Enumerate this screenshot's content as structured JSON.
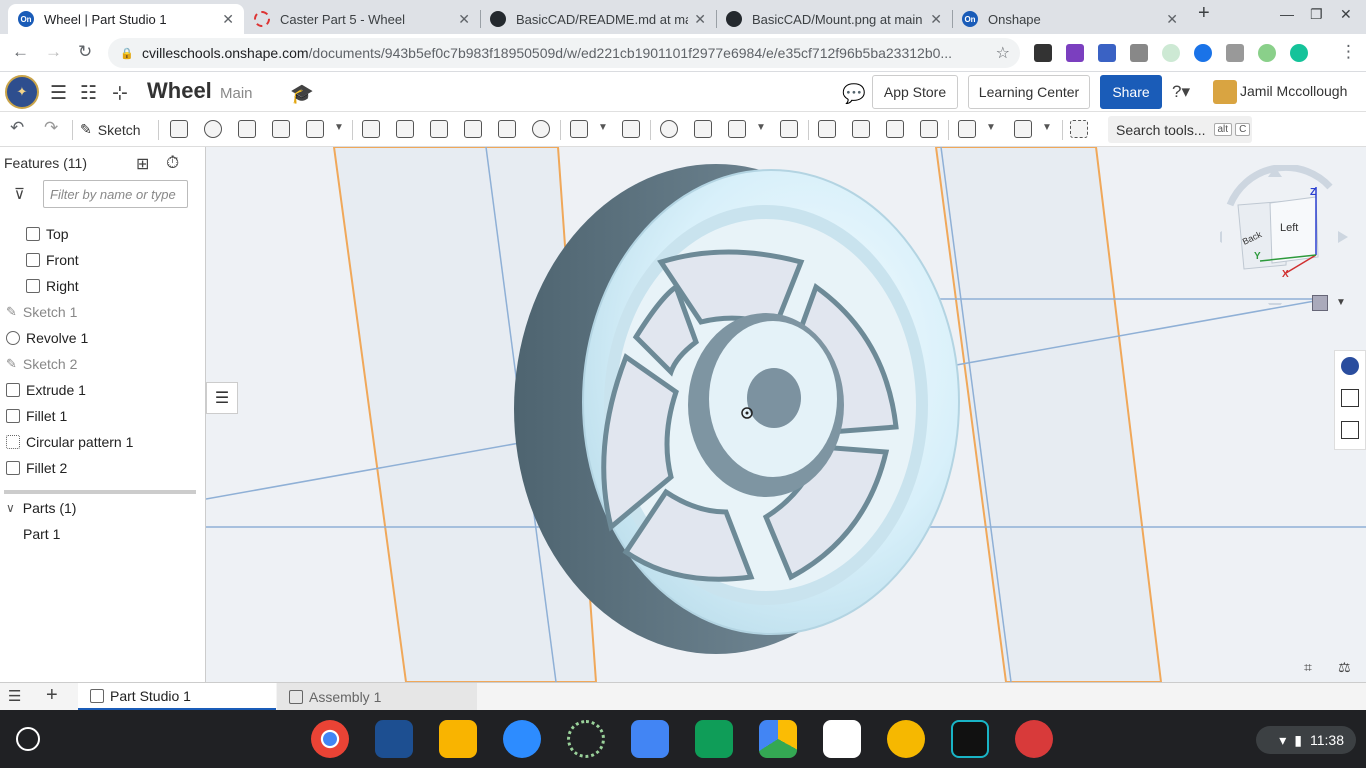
{
  "browser": {
    "tabs": [
      {
        "title": "Wheel | Part Studio 1",
        "icon": "onshape-favicon",
        "active": true
      },
      {
        "title": "Caster Part 5 - Wheel",
        "icon": "dashed-circle-favicon",
        "active": false
      },
      {
        "title": "BasicCAD/README.md at main",
        "icon": "github-favicon",
        "active": false
      },
      {
        "title": "BasicCAD/Mount.png at main",
        "icon": "github-favicon",
        "active": false
      },
      {
        "title": "Onshape",
        "icon": "onshape-favicon",
        "active": false
      }
    ],
    "url_host": "cvilleschools.onshape.com",
    "url_path": "/documents/943b5ef0c7b983f18950509d/w/ed221cb1901101f2977e6984/e/e35cf712f96b5ba23312b0...",
    "favicon_text": "On"
  },
  "header": {
    "document_title": "Wheel",
    "branch": "Main",
    "app_store": "App Store",
    "learning_center": "Learning Center",
    "share": "Share",
    "user_name": "Jamil Mccollough"
  },
  "toolbar": {
    "sketch_label": "Sketch",
    "search_label": "Search tools...",
    "shortcut_1": "alt",
    "shortcut_2": "C"
  },
  "features": {
    "title": "Features (11)",
    "filter_placeholder": "Filter by name or type",
    "items": [
      {
        "label": "Top",
        "icon": "plane-icon",
        "dim": false
      },
      {
        "label": "Front",
        "icon": "plane-icon",
        "dim": false
      },
      {
        "label": "Right",
        "icon": "plane-icon",
        "dim": false
      },
      {
        "label": "Sketch 1",
        "icon": "sketch-icon",
        "dim": true
      },
      {
        "label": "Revolve 1",
        "icon": "revolve-icon",
        "dim": false
      },
      {
        "label": "Sketch 2",
        "icon": "sketch-icon",
        "dim": true
      },
      {
        "label": "Extrude 1",
        "icon": "extrude-icon",
        "dim": false
      },
      {
        "label": "Fillet 1",
        "icon": "fillet-icon",
        "dim": false
      },
      {
        "label": "Circular pattern 1",
        "icon": "circular-pattern-icon",
        "dim": false
      },
      {
        "label": "Fillet 2",
        "icon": "fillet-icon",
        "dim": false
      }
    ],
    "parts_title": "Parts (1)",
    "parts": [
      "Part 1"
    ]
  },
  "view_cube": {
    "face_front": "Left",
    "face_side": "Back",
    "axis_z": "Z",
    "axis_x": "X",
    "axis_y": "Y"
  },
  "bottom_tabs": [
    {
      "label": "Part Studio 1",
      "active": true
    },
    {
      "label": "Assembly 1",
      "active": false
    }
  ],
  "system": {
    "time": "11:38"
  },
  "colors": {
    "accent": "#1a5cb8",
    "wheel_light": "#d8f0fa",
    "wheel_dark": "#5f7480"
  }
}
